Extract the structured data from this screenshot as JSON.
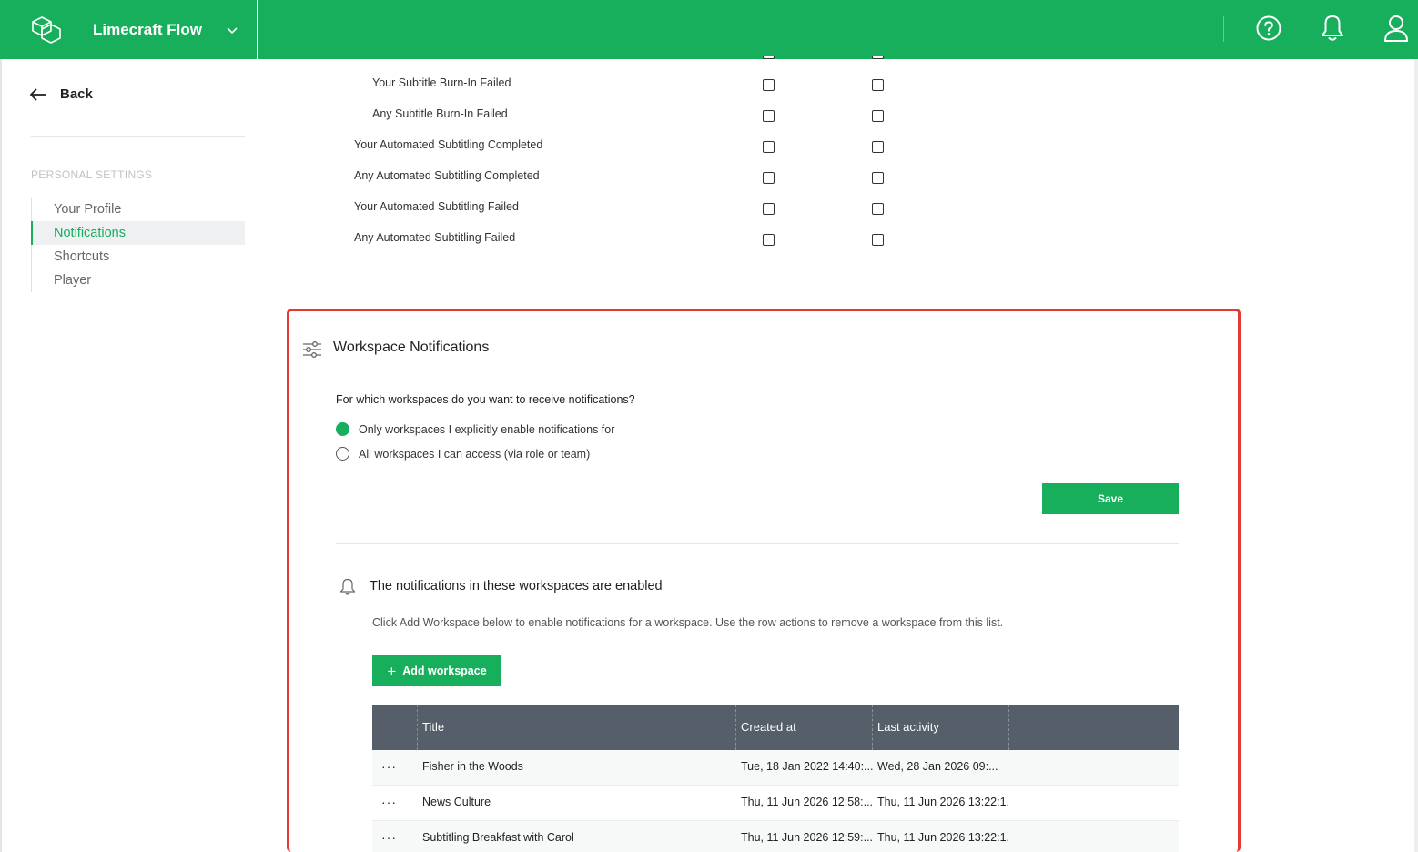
{
  "header": {
    "app_name": "Limecraft Flow",
    "icons": [
      "logo-icon",
      "chevron-down-icon",
      "help-icon",
      "bell-icon",
      "user-icon"
    ],
    "accent_color": "#17ae5c"
  },
  "sidebar": {
    "back_label": "Back",
    "section_label": "PERSONAL SETTINGS",
    "items": [
      {
        "label": "Your Profile",
        "active": false
      },
      {
        "label": "Notifications",
        "active": true
      },
      {
        "label": "Shortcuts",
        "active": false
      },
      {
        "label": "Player",
        "active": false
      }
    ]
  },
  "notification_rows": [
    {
      "label": "Your Subtitle Burn-In Failed"
    },
    {
      "label": "Any Subtitle Burn-In Failed"
    },
    {
      "label": "Your Automated Subtitling Completed"
    },
    {
      "label": "Any Automated Subtitling Completed"
    },
    {
      "label": "Your Automated Subtitling Failed"
    },
    {
      "label": "Any Automated Subtitling Failed"
    }
  ],
  "workspace": {
    "title": "Workspace Notifications",
    "question": "For which workspaces do you want to receive notifications?",
    "options": [
      {
        "label": "Only workspaces I explicitly enable notifications for",
        "selected": true
      },
      {
        "label": "All workspaces I can access (via role or team)",
        "selected": false
      }
    ],
    "save_label": "Save",
    "enabled_title": "The notifications in these workspaces are enabled",
    "help_text": "Click Add Workspace below to enable notifications for a workspace. Use the row actions to remove a workspace from this list.",
    "add_label": "Add workspace",
    "table": {
      "columns": [
        "",
        "Title",
        "Created at",
        "Last activity",
        ""
      ],
      "rows": [
        {
          "actions": "···",
          "title": "Fisher in the Woods",
          "created": "Tue, 18 Jan 2022 14:40:...",
          "last": "Wed, 28 Jan 2026 09:..."
        },
        {
          "actions": "···",
          "title": "News Culture",
          "created": "Thu, 11 Jun 2026 12:58:...",
          "last": "Thu, 11 Jun 2026 13:22:1..."
        },
        {
          "actions": "···",
          "title": "Subtitling Breakfast with Carol",
          "created": "Thu, 11 Jun 2026 12:59:...",
          "last": "Thu, 11 Jun 2026 13:22:1..."
        }
      ]
    }
  }
}
